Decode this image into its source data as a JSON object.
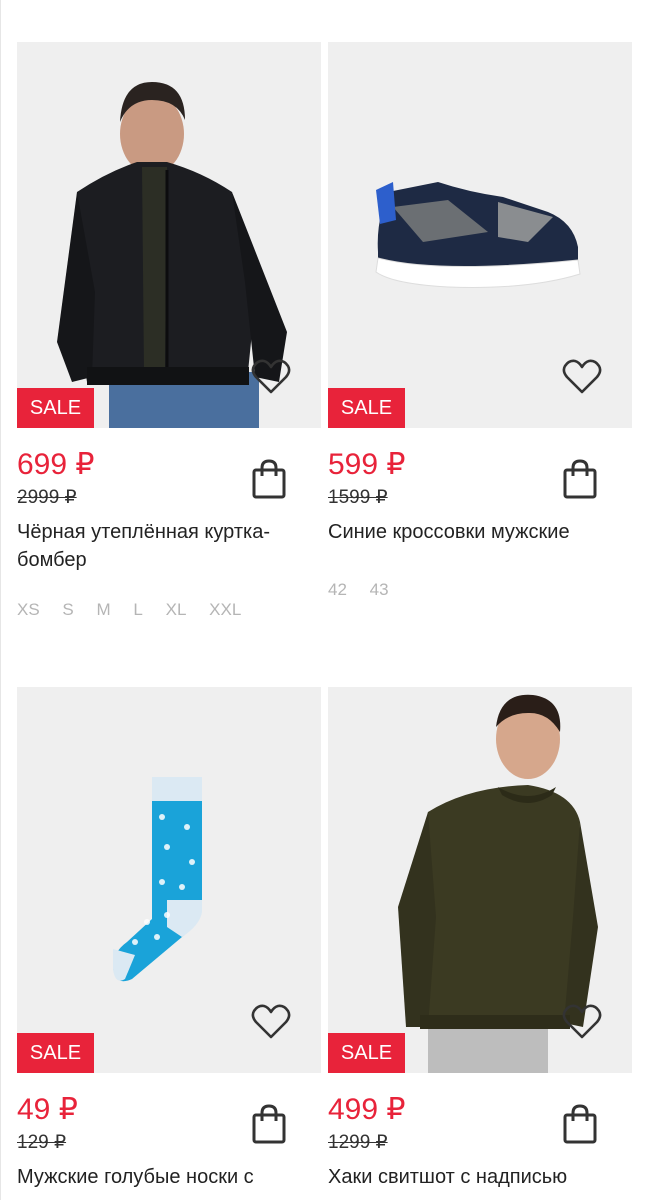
{
  "products": [
    {
      "badge": "SALE",
      "price": "699 ₽",
      "old_price": "2999 ₽",
      "title": "Чёрная утеплённая куртка-бомбер",
      "sizes": [
        "XS",
        "S",
        "M",
        "L",
        "XL",
        "XXL"
      ],
      "image": "black-bomber-jacket"
    },
    {
      "badge": "SALE",
      "price": "599 ₽",
      "old_price": "1599 ₽",
      "title": "Синие кроссовки мужские",
      "sizes": [
        "42",
        "43"
      ],
      "image": "navy-sneaker"
    },
    {
      "badge": "SALE",
      "price": "49 ₽",
      "old_price": "129 ₽",
      "title": "Мужские голубые носки с",
      "sizes": [],
      "image": "blue-patterned-sock"
    },
    {
      "badge": "SALE",
      "price": "499 ₽",
      "old_price": "1299 ₽",
      "title": "Хаки свитшот с надписью",
      "sizes": [],
      "image": "khaki-sweatshirt"
    }
  ],
  "colors": {
    "accent": "#e8233a",
    "image_bg": "#efefef",
    "size_text": "#b5b5b5"
  },
  "icons": {
    "favorite": "heart-outline-icon",
    "cart": "shopping-bag-icon"
  }
}
